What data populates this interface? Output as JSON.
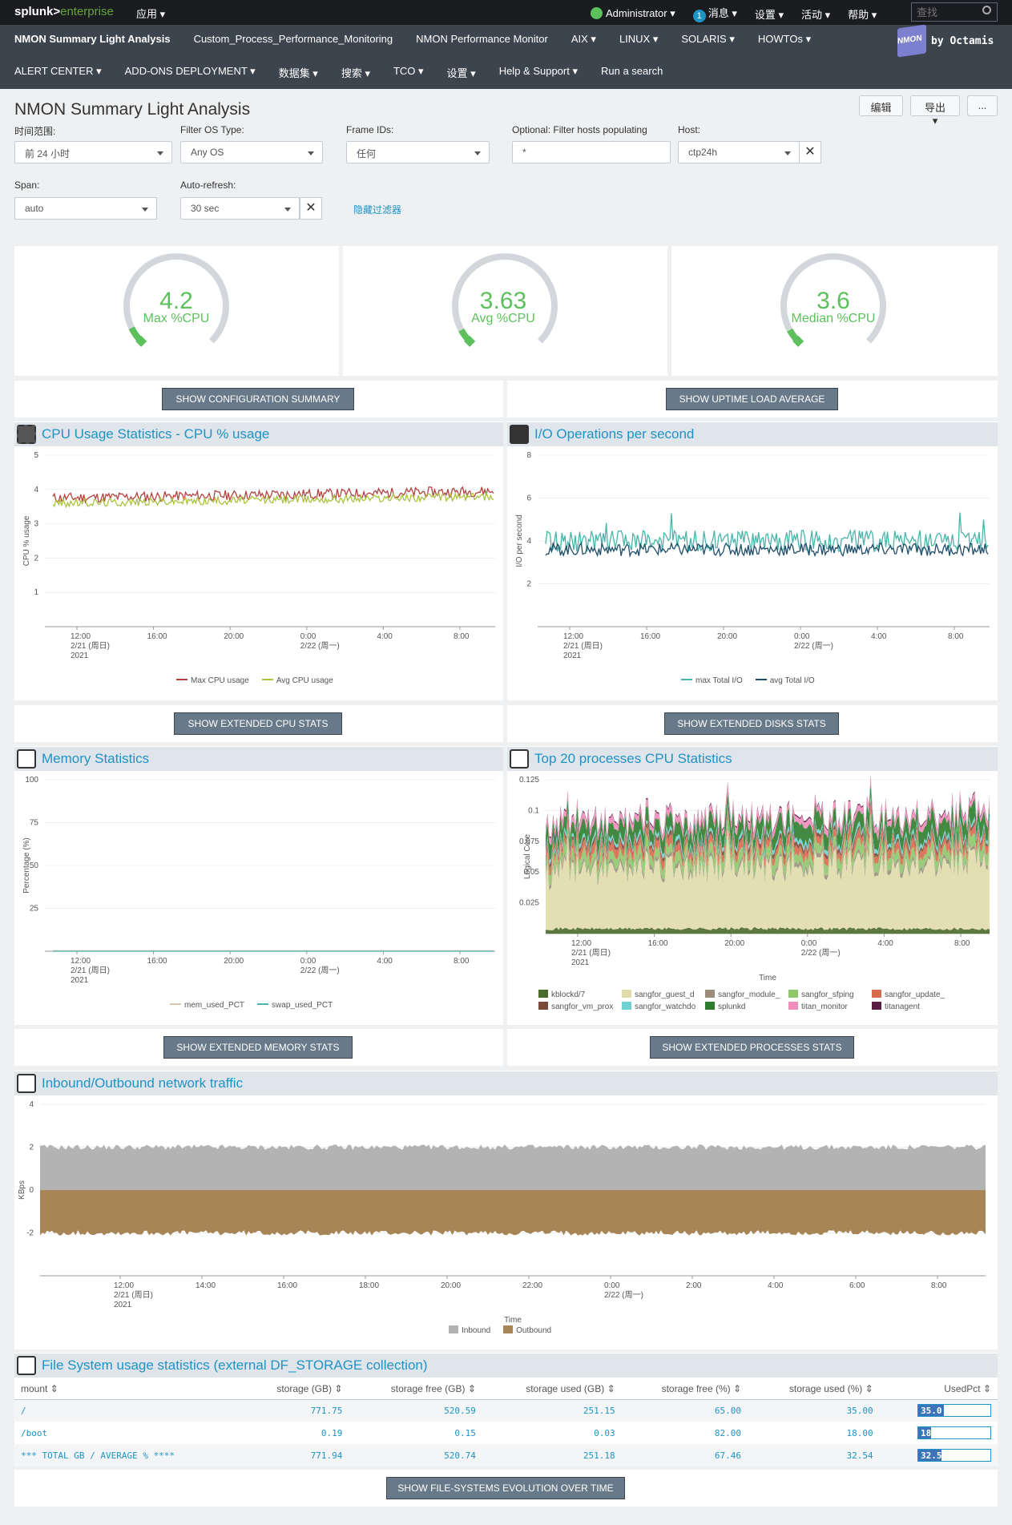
{
  "topbar": {
    "logo_main": "splunk>",
    "logo_sub": "enterprise",
    "apps": "应用 ▾",
    "user": "Administrator ▾",
    "msg_count": "1",
    "messages": "消息 ▾",
    "settings": "设置 ▾",
    "activity": "活动 ▾",
    "help": "帮助 ▾",
    "search_placeholder": "查找"
  },
  "nav": {
    "row1": [
      "NMON Summary Light Analysis",
      "Custom_Process_Performance_Monitoring",
      "NMON Performance Monitor",
      "AIX ▾",
      "LINUX ▾",
      "SOLARIS ▾",
      "HOWTOs ▾"
    ],
    "row2": [
      "ALERT CENTER ▾",
      "ADD-ONS DEPLOYMENT ▾",
      "数据集 ▾",
      "搜索 ▾",
      "TCO ▾",
      "设置 ▾",
      "Help & Support ▾",
      "Run a search"
    ],
    "brand_cube": "NMON",
    "brand_by": "by Octamis"
  },
  "page": {
    "title": "NMON Summary Light Analysis",
    "edit": "编辑",
    "export": "导出 ▾",
    "more": "..."
  },
  "filters": {
    "time_label": "时间范围:",
    "time_value": "前 24 小时",
    "os_label": "Filter OS Type:",
    "os_value": "Any OS",
    "frame_label": "Frame IDs:",
    "frame_value": "任何",
    "filter_label": "Optional: Filter hosts populating",
    "filter_value": "*",
    "host_label": "Host:",
    "host_value": "ctp24h",
    "span_label": "Span:",
    "span_value": "auto",
    "refresh_label": "Auto-refresh:",
    "refresh_value": "30 sec",
    "hide": "隐藏过滤器"
  },
  "gauges": [
    {
      "value": "4.2",
      "label": "Max %CPU",
      "fraction": 0.07
    },
    {
      "value": "3.63",
      "label": "Avg %CPU",
      "fraction": 0.06
    },
    {
      "value": "3.6",
      "label": "Median %CPU",
      "fraction": 0.06
    }
  ],
  "buttons": {
    "config": "SHOW CONFIGURATION SUMMARY",
    "uptime": "SHOW UPTIME LOAD AVERAGE",
    "cpu": "SHOW EXTENDED CPU STATS",
    "disks": "SHOW EXTENDED DISKS STATS",
    "mem": "SHOW EXTENDED MEMORY STATS",
    "proc": "SHOW EXTENDED PROCESSES STATS",
    "fs": "SHOW FILE-SYSTEMS EVOLUTION OVER TIME"
  },
  "panels": {
    "cpu": "CPU Usage Statistics - CPU % usage",
    "io": "I/O Operations per second",
    "mem": "Memory Statistics",
    "proc": "Top 20 processes CPU Statistics",
    "net": "Inbound/Outbound network traffic",
    "fs": "File System usage statistics (external DF_STORAGE collection)"
  },
  "time_axis": {
    "xlabel": "Time",
    "ticks": [
      {
        "l1": "12:00",
        "l2": "2/21 (周日)",
        "l3": "2021"
      },
      {
        "l1": "16:00"
      },
      {
        "l1": "20:00"
      },
      {
        "l1": "0:00",
        "l2": "2/22 (周一)"
      },
      {
        "l1": "4:00"
      },
      {
        "l1": "8:00"
      }
    ],
    "net_ticks": [
      {
        "l1": "12:00",
        "l2": "2/21 (周日)",
        "l3": "2021"
      },
      {
        "l1": "14:00"
      },
      {
        "l1": "16:00"
      },
      {
        "l1": "18:00"
      },
      {
        "l1": "20:00"
      },
      {
        "l1": "22:00"
      },
      {
        "l1": "0:00",
        "l2": "2/22 (周一)"
      },
      {
        "l1": "2:00"
      },
      {
        "l1": "4:00"
      },
      {
        "l1": "6:00"
      },
      {
        "l1": "8:00"
      }
    ]
  },
  "chart_data": [
    {
      "id": "cpu",
      "type": "line",
      "ylabel": "CPU % usage",
      "ylim": [
        0,
        5
      ],
      "yticks": [
        "1",
        "2",
        "3",
        "4",
        "5"
      ],
      "series": [
        {
          "name": "Max CPU usage",
          "color": "#b5423f",
          "base": 3.75,
          "spread": 0.15,
          "trend": 0.2
        },
        {
          "name": "Avg CPU usage",
          "color": "#a9c33e",
          "base": 3.6,
          "spread": 0.12,
          "trend": 0.2
        }
      ]
    },
    {
      "id": "io",
      "type": "line",
      "ylabel": "I/O per second",
      "ylim": [
        0,
        8
      ],
      "yticks": [
        "2",
        "4",
        "6",
        "8"
      ],
      "series": [
        {
          "name": "max Total I/O",
          "color": "#49b5a9",
          "base": 4.0,
          "spread": 0.5,
          "trend": 0
        },
        {
          "name": "avg Total I/O",
          "color": "#1f4e6a",
          "base": 3.6,
          "spread": 0.3,
          "trend": 0
        }
      ]
    },
    {
      "id": "mem",
      "type": "line",
      "ylabel": "Percentage (%)",
      "ylim": [
        0,
        100
      ],
      "yticks": [
        "25",
        "50",
        "75",
        "100"
      ],
      "series": [
        {
          "name": "mem_used_PCT",
          "color": "#d6c6b0",
          "base": 0.3,
          "spread": 0,
          "trend": 0
        },
        {
          "name": "swap_used_PCT",
          "color": "#49b5a9",
          "base": 0.0,
          "spread": 0,
          "trend": 0
        }
      ]
    },
    {
      "id": "proc",
      "type": "area",
      "ylabel": "Logical Core",
      "ylim": [
        0,
        0.125
      ],
      "yticks": [
        "0.025",
        "0.05",
        "0.075",
        "0.1",
        "0.125"
      ],
      "series": [
        {
          "name": "kblockd/7",
          "color": "#4a6b2a"
        },
        {
          "name": "sangfor_guest_d",
          "color": "#e0dcaa"
        },
        {
          "name": "sangfor_module_",
          "color": "#998e7c"
        },
        {
          "name": "sangfor_sfping",
          "color": "#8ec86a"
        },
        {
          "name": "sangfor_update_",
          "color": "#d9694c"
        },
        {
          "name": "sangfor_vm_prox",
          "color": "#7a4a3a"
        },
        {
          "name": "sangfor_watchdo",
          "color": "#6fd2d0"
        },
        {
          "name": "splunkd",
          "color": "#2e7d2e"
        },
        {
          "name": "titan_monitor",
          "color": "#ef8dbb"
        },
        {
          "name": "titanagent",
          "color": "#5b1a3f"
        }
      ]
    },
    {
      "id": "net",
      "type": "area",
      "ylabel": "KBps",
      "ylim": [
        -4,
        4
      ],
      "yticks": [
        "-2",
        "0",
        "2",
        "4"
      ],
      "series": [
        {
          "name": "Inbound",
          "color": "#b3b3b3",
          "base": 2.0
        },
        {
          "name": "Outbound",
          "color": "#a88556",
          "base": -2.0
        }
      ]
    }
  ],
  "fs_table": {
    "columns": [
      "mount ⇕",
      "storage (GB) ⇕",
      "storage free (GB) ⇕",
      "storage used (GB) ⇕",
      "storage free (%) ⇕",
      "storage used (%) ⇕",
      "UsedPct ⇕"
    ],
    "rows": [
      {
        "mount": "/",
        "storage": "771.75",
        "free": "520.59",
        "used": "251.15",
        "free_pct": "65.00",
        "used_pct": "35.00",
        "bar_label": "35.0",
        "bar": 0.35
      },
      {
        "mount": "/boot",
        "storage": "0.19",
        "free": "0.15",
        "used": "0.03",
        "free_pct": "82.00",
        "used_pct": "18.00",
        "bar_label": "18.0",
        "bar": 0.18
      },
      {
        "mount": "*** TOTAL GB / AVERAGE % ****",
        "storage": "771.94",
        "free": "520.74",
        "used": "251.18",
        "free_pct": "67.46",
        "used_pct": "32.54",
        "bar_label": "32.5",
        "bar": 0.325
      }
    ]
  }
}
